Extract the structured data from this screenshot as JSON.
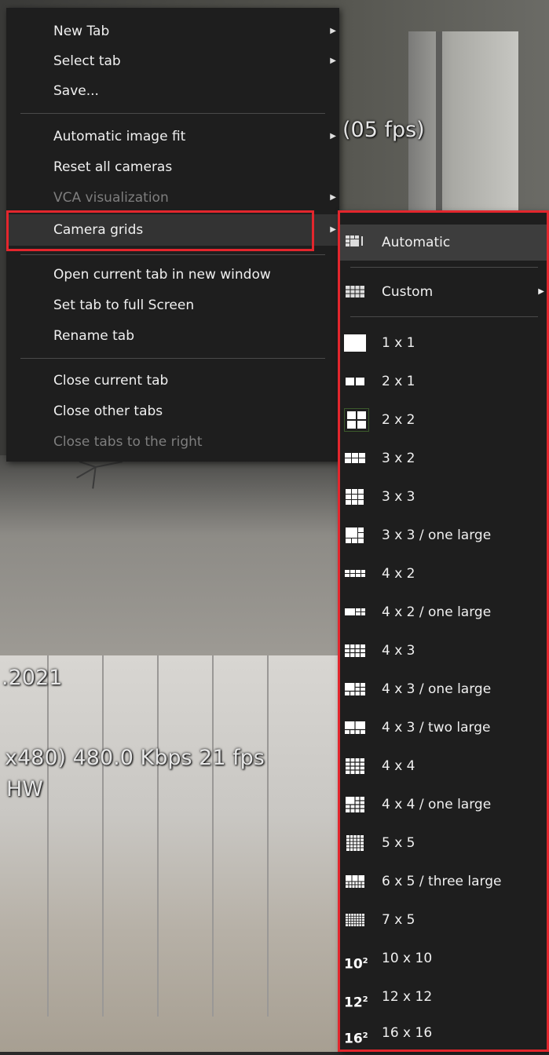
{
  "feeds": {
    "top_overlay": "(05 fps)",
    "bottom_date": ".2021",
    "bottom_stream": "x480) 480.0 Kbps 21 fps",
    "bottom_hw": "HW"
  },
  "main_menu": {
    "items": [
      {
        "label": "New Tab",
        "has_submenu": true,
        "disabled": false
      },
      {
        "label": "Select tab",
        "has_submenu": true,
        "disabled": false
      },
      {
        "label": "Save...",
        "has_submenu": false,
        "disabled": false
      },
      {
        "label": "Automatic image fit",
        "has_submenu": true,
        "disabled": false
      },
      {
        "label": "Reset all cameras",
        "has_submenu": false,
        "disabled": false
      },
      {
        "label": "VCA visualization",
        "has_submenu": true,
        "disabled": true
      },
      {
        "label": "Camera grids",
        "has_submenu": true,
        "disabled": false,
        "selected": true
      },
      {
        "label": "Open current tab in new window",
        "has_submenu": false,
        "disabled": false
      },
      {
        "label": "Set tab to full Screen",
        "has_submenu": false,
        "disabled": false
      },
      {
        "label": "Rename tab",
        "has_submenu": false,
        "disabled": false
      },
      {
        "label": "Close current tab",
        "has_submenu": false,
        "disabled": false
      },
      {
        "label": "Close other tabs",
        "has_submenu": false,
        "disabled": false
      },
      {
        "label": "Close tabs to the right",
        "has_submenu": false,
        "disabled": true
      }
    ]
  },
  "grid_menu": {
    "items": [
      {
        "label": "Automatic",
        "icon": "auto-grid-icon",
        "selected": true
      },
      {
        "label": "Custom",
        "icon": "custom-grid-icon",
        "has_submenu": true
      },
      {
        "label": "1 x 1",
        "icon": "grid-1x1-icon"
      },
      {
        "label": "2 x 1",
        "icon": "grid-2x1-icon"
      },
      {
        "label": "2 x 2",
        "icon": "grid-2x2-icon"
      },
      {
        "label": "3 x 2",
        "icon": "grid-3x2-icon"
      },
      {
        "label": "3 x 3",
        "icon": "grid-3x3-icon"
      },
      {
        "label": "3 x 3 / one large",
        "icon": "grid-3x3-one-large-icon"
      },
      {
        "label": "4 x 2",
        "icon": "grid-4x2-icon"
      },
      {
        "label": "4 x 2 / one large",
        "icon": "grid-4x2-one-large-icon"
      },
      {
        "label": "4 x 3",
        "icon": "grid-4x3-icon"
      },
      {
        "label": "4 x 3 / one large",
        "icon": "grid-4x3-one-large-icon"
      },
      {
        "label": "4 x 3 / two large",
        "icon": "grid-4x3-two-large-icon"
      },
      {
        "label": "4 x 4",
        "icon": "grid-4x4-icon"
      },
      {
        "label": "4 x 4 / one large",
        "icon": "grid-4x4-one-large-icon"
      },
      {
        "label": "5 x 5",
        "icon": "grid-5x5-icon"
      },
      {
        "label": "6 x 5 / three large",
        "icon": "grid-6x5-three-large-icon"
      },
      {
        "label": "7 x 5",
        "icon": "grid-7x5-icon"
      },
      {
        "label": "10 x 10",
        "icon": "grid-10x10-icon",
        "badge": "10",
        "badge_exp": "2"
      },
      {
        "label": "12 x 12",
        "icon": "grid-12x12-icon",
        "badge": "12",
        "badge_exp": "2"
      },
      {
        "label": "16 x 16",
        "icon": "grid-16x16-icon",
        "badge": "16",
        "badge_exp": "2"
      }
    ]
  },
  "colors": {
    "menu_bg": "#1e1e1e",
    "highlight_red": "#e3262d",
    "disabled_text": "#7e7e7e"
  }
}
